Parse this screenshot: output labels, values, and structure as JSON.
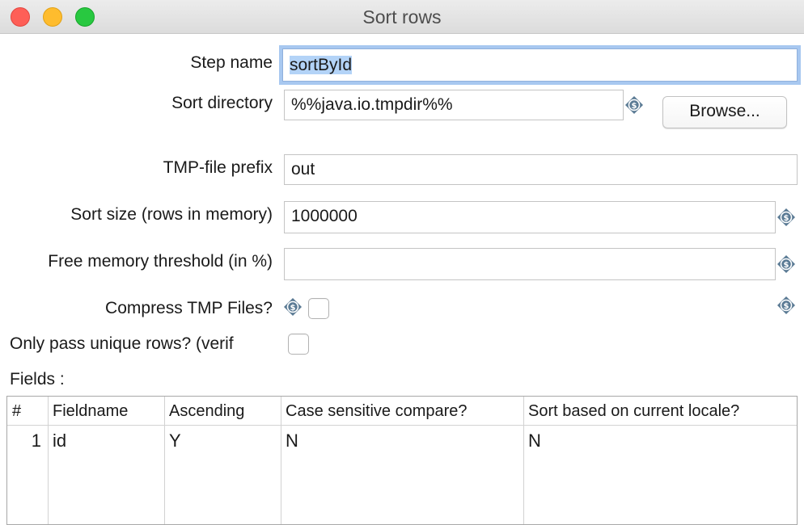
{
  "window": {
    "title": "Sort rows"
  },
  "form": {
    "step_name_label": "Step name",
    "step_name_value": "sortById",
    "sort_directory_label": "Sort directory",
    "sort_directory_value": "%%java.io.tmpdir%%",
    "browse_label": "Browse...",
    "tmp_prefix_label": "TMP-file prefix",
    "tmp_prefix_value": "out",
    "sort_size_label": "Sort size (rows in memory)",
    "sort_size_value": "1000000",
    "free_memory_label": "Free memory threshold (in %)",
    "free_memory_value": "",
    "compress_label": "Compress TMP Files?",
    "compress_checked": false,
    "unique_label": "Only pass unique rows? (verif",
    "unique_checked": false,
    "fields_label": "Fields :"
  },
  "table": {
    "headers": [
      "#",
      "Fieldname",
      "Ascending",
      "Case sensitive compare?",
      "Sort based on current locale?"
    ],
    "rows": [
      {
        "num": "1",
        "fieldname": "id",
        "ascending": "Y",
        "case_sensitive": "N",
        "locale": "N"
      }
    ]
  },
  "icons": {
    "variable": "variable-dollar-icon"
  },
  "colors": {
    "focus_ring": "#a8c8f0",
    "selection": "#b3d3f7",
    "variable_icon": "#5a7a94"
  }
}
